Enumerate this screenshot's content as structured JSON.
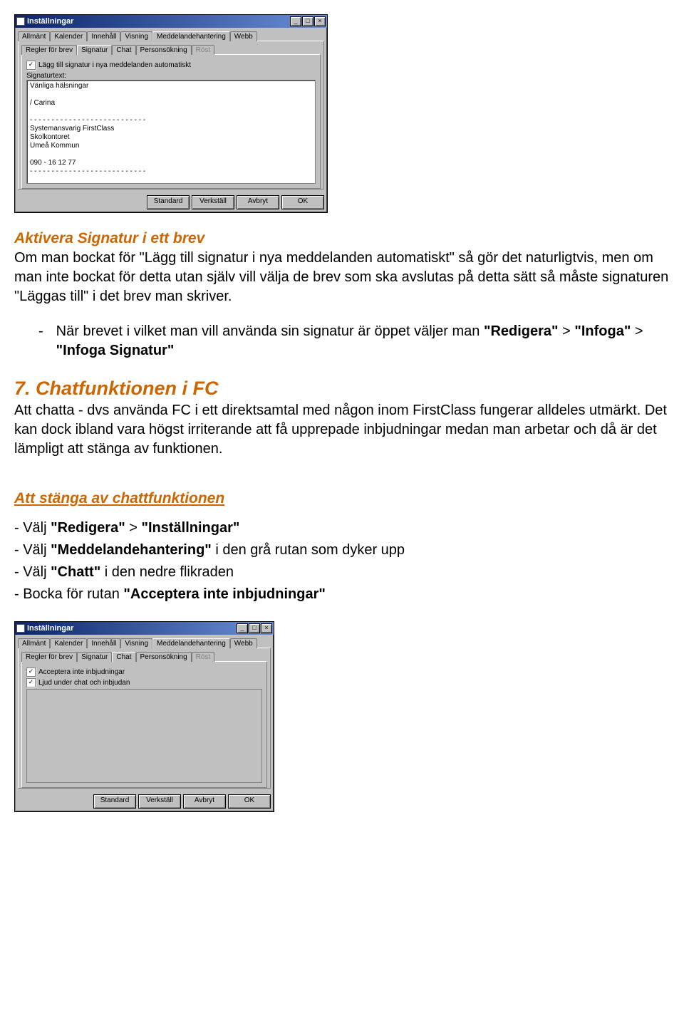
{
  "dialog1": {
    "title": "Inställningar",
    "topTabs": [
      "Allmänt",
      "Kalender",
      "Innehåll",
      "Visning",
      "Meddelandehantering",
      "Webb"
    ],
    "topActive": "Meddelandehantering",
    "subTabs": [
      "Regler för brev",
      "Signatur",
      "Chat",
      "Personsökning",
      "Röst"
    ],
    "subActive": "Signatur",
    "checkbox": "Lägg till signatur i nya meddelanden automatiskt",
    "sigLabel": "Signaturtext:",
    "sigText": "Vänliga hälsningar\n\n/ Carina\n\n- - - - - - - - - - - - - - - - - - - - - - - - - - -\nSystemansvarig FirstClass\nSkolkontoret\nUmeå Kommun\n\n090 - 16 12 77\n- - - - - - - - - - - - - - - - - - - - - - - - - - -",
    "buttons": {
      "standard": "Standard",
      "verkstall": "Verkställ",
      "avbryt": "Avbryt",
      "ok": "OK"
    }
  },
  "doc": {
    "h_activate": "Aktivera Signatur i ett brev",
    "p_activate": "Om man bockat för \"Lägg till signatur i nya meddelanden automatiskt\" så gör det naturligtvis, men om man inte bockat för detta utan själv vill välja de brev som ska avslutas på detta sätt så måste signaturen \"Läggas till\" i det brev man skriver.",
    "bullet1_pre": "När brevet i vilket man vill använda sin signatur är öppet väljer man ",
    "bullet1_b1": "\"Redigera\"",
    "bullet1_mid1": " > ",
    "bullet1_b2": "\"Infoga\"",
    "bullet1_mid2": " > ",
    "bullet1_b3": "\"Infoga Signatur\"",
    "h7": "7. Chatfunktionen i FC",
    "p7": "Att chatta - dvs använda FC i ett direktsamtal med någon inom FirstClass fungerar alldeles utmärkt. Det kan dock ibland vara högst irriterande att få upprepade inbjudningar medan man arbetar och då är det lämpligt att stänga av funktionen.",
    "h_close": "Att stänga av chattfunktionen",
    "step1_pre": "- Välj ",
    "step1_b1": "\"Redigera\"",
    "step1_mid": " > ",
    "step1_b2": "\"Inställningar\"",
    "step2_pre": "- Välj ",
    "step2_b": "\"Meddelandehantering\"",
    "step2_post": "  i den grå rutan som dyker upp",
    "step3_pre": "- Välj ",
    "step3_b": "\"Chatt\"",
    "step3_post": "  i den nedre flikraden",
    "step4_pre": "- Bocka för rutan ",
    "step4_b": "\"Acceptera inte inbjudningar\""
  },
  "dialog2": {
    "title": "Inställningar",
    "topTabs": [
      "Allmänt",
      "Kalender",
      "Innehåll",
      "Visning",
      "Meddelandehantering",
      "Webb"
    ],
    "topActive": "Meddelandehantering",
    "subTabs": [
      "Regler för brev",
      "Signatur",
      "Chat",
      "Personsökning",
      "Röst"
    ],
    "subActive": "Chat",
    "cb1": "Acceptera inte inbjudningar",
    "cb2": "Ljud under chat och inbjudan",
    "buttons": {
      "standard": "Standard",
      "verkstall": "Verkställ",
      "avbryt": "Avbryt",
      "ok": "OK"
    }
  }
}
